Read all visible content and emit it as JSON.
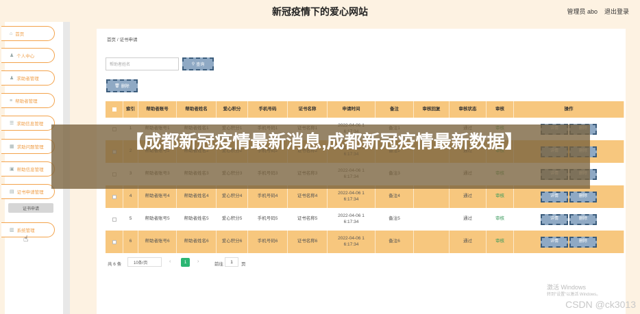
{
  "header": {
    "title": "新冠疫情下的爱心网站",
    "admin": "管理员 abo",
    "logout": "退出登录"
  },
  "sidebar": {
    "items": [
      {
        "label": "首页",
        "icon": "home-icon",
        "glyph": "⌂"
      },
      {
        "label": "个人中心",
        "icon": "user-icon",
        "glyph": "♟"
      },
      {
        "label": "求助者管理",
        "icon": "user-icon",
        "glyph": "♟"
      },
      {
        "label": "帮助者管理",
        "icon": "list-icon",
        "glyph": "≡"
      },
      {
        "label": "求助信息管理",
        "icon": "list-icon",
        "glyph": "☰"
      },
      {
        "label": "求助问题管理",
        "icon": "grid-icon",
        "glyph": "▦"
      },
      {
        "label": "帮助信息管理",
        "icon": "box-icon",
        "glyph": "▣"
      },
      {
        "label": "证书申请管理",
        "icon": "doc-icon",
        "glyph": "▤"
      },
      {
        "label": "系统管理",
        "icon": "chart-icon",
        "glyph": "▥"
      }
    ],
    "sub_item": "证书申请"
  },
  "breadcrumb": {
    "home": "首页",
    "sep": "/",
    "current": "证书申请"
  },
  "search": {
    "placeholder": "帮助者姓名",
    "button": "查询"
  },
  "toolbar": {
    "delete": "删除"
  },
  "table": {
    "headers": [
      "",
      "索引",
      "帮助者账号",
      "帮助者姓名",
      "爱心积分",
      "手机号码",
      "证书名称",
      "申请时间",
      "备注",
      "审核回复",
      "审核状态",
      "审核",
      "操作"
    ],
    "rows": [
      {
        "idx": "1",
        "account": "帮助者账号1",
        "name": "帮助者姓名1",
        "points": "爱心积分1",
        "phone": "手机号码1",
        "cert": "证书名称1",
        "time": "2022-04-06 1\n6:17:34",
        "note": "备注1",
        "reply": "",
        "status": "通过",
        "audit": "审核"
      },
      {
        "idx": "2",
        "account": "帮助者账号2",
        "name": "帮助者姓名2",
        "points": "爱心积分2",
        "phone": "手机号码2",
        "cert": "证书名称2",
        "time": "2022-04-06 1\n6:17:34",
        "note": "备注2",
        "reply": "",
        "status": "通过",
        "audit": "审核"
      },
      {
        "idx": "3",
        "account": "帮助者账号3",
        "name": "帮助者姓名3",
        "points": "爱心积分3",
        "phone": "手机号码3",
        "cert": "证书名称3",
        "time": "2022-04-06 1\n6:17:34",
        "note": "备注3",
        "reply": "",
        "status": "通过",
        "audit": "审核"
      },
      {
        "idx": "4",
        "account": "帮助者账号4",
        "name": "帮助者姓名4",
        "points": "爱心积分4",
        "phone": "手机号码4",
        "cert": "证书名称4",
        "time": "2022-04-06 1\n6:17:34",
        "note": "备注4",
        "reply": "",
        "status": "通过",
        "audit": "审核"
      },
      {
        "idx": "5",
        "account": "帮助者账号5",
        "name": "帮助者姓名5",
        "points": "爱心积分5",
        "phone": "手机号码5",
        "cert": "证书名称5",
        "time": "2022-04-06 1\n6:17:34",
        "note": "备注5",
        "reply": "",
        "status": "通过",
        "audit": "审核"
      },
      {
        "idx": "6",
        "account": "帮助者账号6",
        "name": "帮助者姓名6",
        "points": "爱心积分6",
        "phone": "手机号码6",
        "cert": "证书名称6",
        "time": "2022-04-06 1\n6:17:34",
        "note": "备注6",
        "reply": "",
        "status": "通过",
        "audit": "审核"
      }
    ],
    "detail_button": "详情",
    "delete_button": "删除"
  },
  "pagination": {
    "total": "共 6 条",
    "page_size": "10条/页",
    "current": "1",
    "goto": "前往",
    "goto_value": "1",
    "unit": "页"
  },
  "overlay": {
    "text": "【成都新冠疫情最新消息,成都新冠疫情最新数据】"
  },
  "watermarks": {
    "windows": "激活 Windows",
    "windows_sub": "转到\"设置\"以激活 Windows。",
    "csdn": "CSDN @ck3013"
  },
  "colors": {
    "accent": "#f3a24a",
    "header_row": "#f7c77e",
    "button": "#8fa9c4",
    "pager_active": "#2bb673",
    "audit": "#3a9a5c"
  }
}
